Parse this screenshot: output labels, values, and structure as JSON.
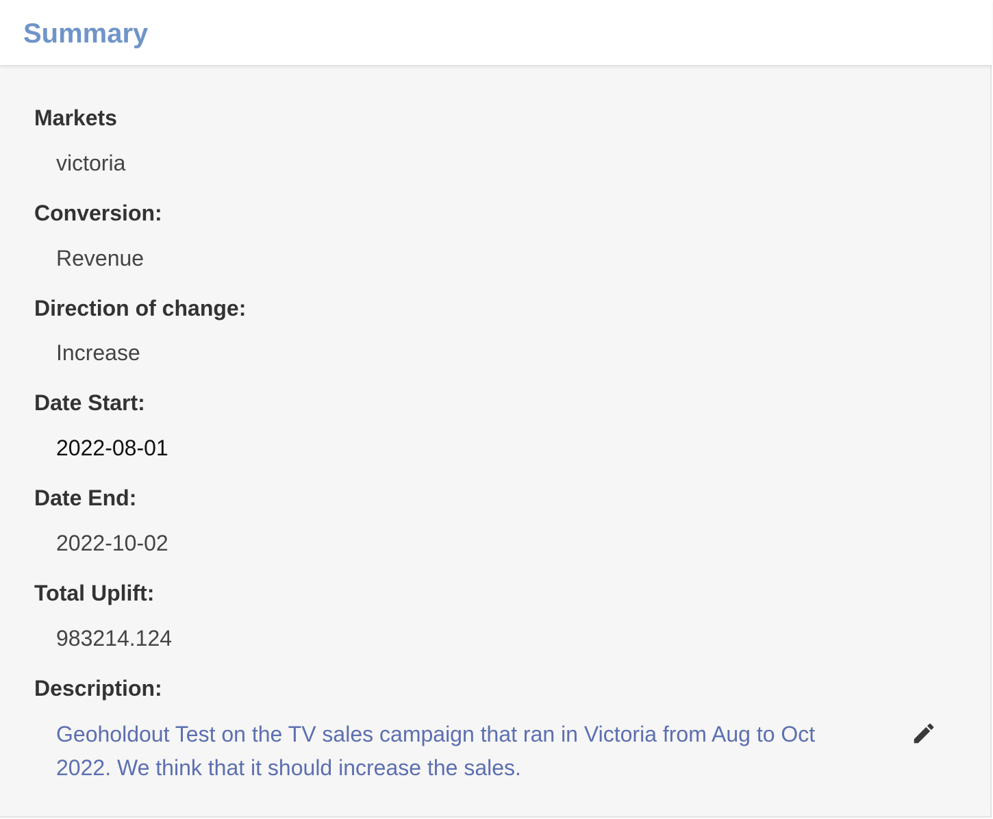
{
  "header": {
    "title": "Summary"
  },
  "fields": [
    {
      "label": "Markets",
      "value": "victoria"
    },
    {
      "label": "Conversion:",
      "value": "Revenue"
    },
    {
      "label": "Direction of change:",
      "value": "Increase"
    },
    {
      "label": "Date Start:",
      "value": "2022-08-01"
    },
    {
      "label": "Date End:",
      "value": "2022-10-02"
    },
    {
      "label": "Total Uplift:",
      "value": "983214.124"
    }
  ],
  "description": {
    "label": "Description:",
    "text": "Geoholdout Test on the TV sales campaign that ran in Victoria from Aug to Oct 2022. We think that it should increase the sales.",
    "edit_icon": "pencil-icon"
  },
  "colors": {
    "title": "#6f94c8",
    "description_text": "#5c6fb0",
    "label": "#333333",
    "value": "#444444"
  }
}
